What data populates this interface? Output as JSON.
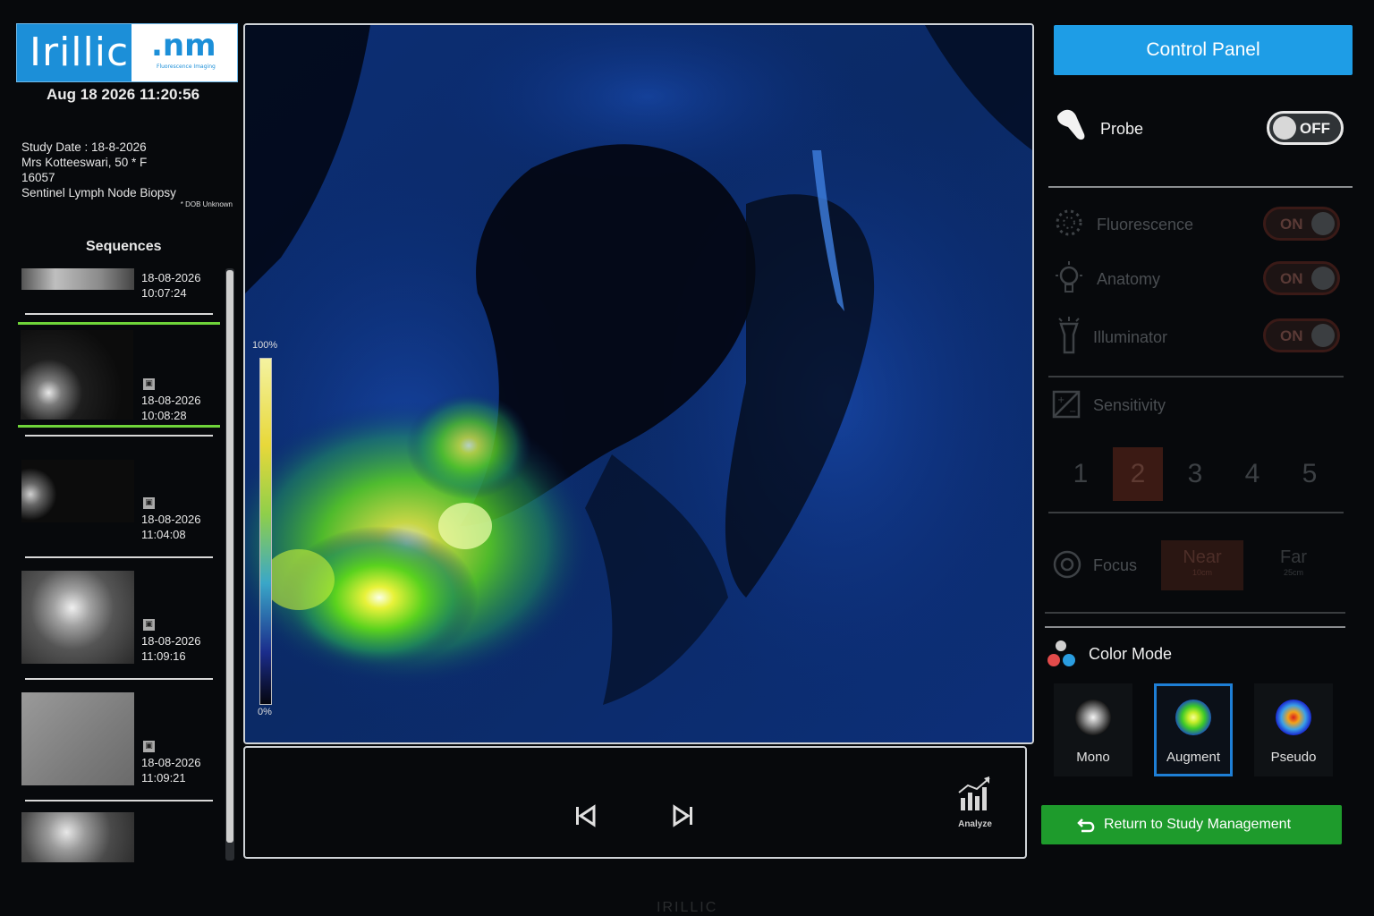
{
  "brand": {
    "name": "Irillic",
    "badge_mark": ".nm",
    "badge_sub": "Fluorescence Imaging",
    "footer": "IRILLIC"
  },
  "clock": "Aug 18 2026 11:20:56",
  "patient": {
    "study_date": "Study Date : 18-8-2026",
    "name_line": "Mrs Kotteeswari, 50 * F",
    "id": "16057",
    "procedure": "Sentinel Lymph Node Biopsy",
    "dob_note": "* DOB Unknown"
  },
  "sequences": {
    "title": "Sequences",
    "items": [
      {
        "date": "18-08-2026",
        "time": "10:07:24"
      },
      {
        "date": "18-08-2026",
        "time": "10:08:28",
        "selected": true
      },
      {
        "date": "18-08-2026",
        "time": "11:04:08"
      },
      {
        "date": "18-08-2026",
        "time": "11:09:16"
      },
      {
        "date": "18-08-2026",
        "time": "11:09:21"
      }
    ]
  },
  "colorbar": {
    "max_label": "100%",
    "min_label": "0%"
  },
  "transport": {
    "analyze_label": "Analyze"
  },
  "control_panel": {
    "title": "Control Panel",
    "probe": {
      "label": "Probe",
      "state": "OFF"
    },
    "fluorescence": {
      "label": "Fluorescence",
      "state": "ON"
    },
    "anatomy": {
      "label": "Anatomy",
      "state": "ON"
    },
    "illuminator": {
      "label": "Illuminator",
      "state": "ON"
    },
    "sensitivity": {
      "label": "Sensitivity",
      "levels": [
        "1",
        "2",
        "3",
        "4",
        "5"
      ],
      "selected": "2"
    },
    "focus": {
      "label": "Focus",
      "near": {
        "label": "Near",
        "sub": "10cm"
      },
      "far": {
        "label": "Far",
        "sub": "25cm"
      },
      "selected": "Near"
    },
    "color_mode": {
      "label": "Color Mode",
      "options": [
        "Mono",
        "Augment",
        "Pseudo"
      ],
      "selected": "Augment"
    },
    "return_button": "Return to Study Management"
  },
  "colors": {
    "accent_blue": "#1e9de6",
    "selected_green": "#6fd43a",
    "return_green": "#1e9b2c"
  }
}
